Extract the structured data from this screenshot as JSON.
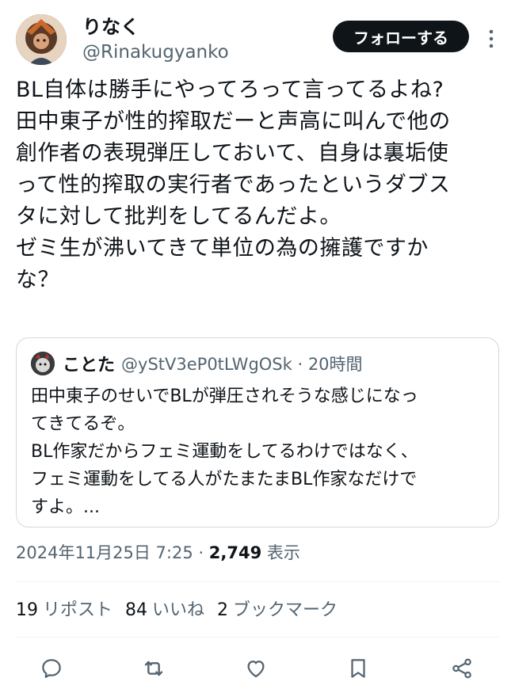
{
  "author": {
    "display_name": "りなく",
    "handle": "@Rinakugyanko",
    "follow_label": "フォローする"
  },
  "tweet": {
    "text": "BL自体は勝手にやってろって言ってるよね?\n田中東子が性的搾取だーと声高に叫んで他の\n創作者の表現弾圧しておいて、自身は裏垢使\nって性的搾取の実行者であったというダブス\nタに対して批判をしてるんだよ。\nゼミ生が沸いてきて単位の為の擁護ですか\nな？"
  },
  "quote": {
    "display_name": "ことた",
    "handle_time": "@yStV3eP0tLWgOSk · 20時間",
    "text": "田中東子のせいでBLが弾圧されそうな感じになっ\nてきてるぞ。\nBL作家だからフェミ運動をしてるわけではなく、\nフェミ運動をしてる人がたまたまBL作家なだけで\nすよ。..."
  },
  "meta": {
    "timestamp": "2024年11月25日 7:25",
    "separator": " · ",
    "views_count": "2,749",
    "views_label": "表示"
  },
  "stats": {
    "reposts_count": "19",
    "reposts_label": "リポスト",
    "likes_count": "84",
    "likes_label": "いいね",
    "bookmarks_count": "2",
    "bookmarks_label": "ブックマーク"
  },
  "actions": [
    "reply-icon",
    "repost-icon",
    "like-icon",
    "bookmark-icon",
    "share-icon"
  ],
  "colors": {
    "text": "#0f1419",
    "secondary": "#536471",
    "border": "#cfd9de",
    "button": "#0f1419"
  }
}
